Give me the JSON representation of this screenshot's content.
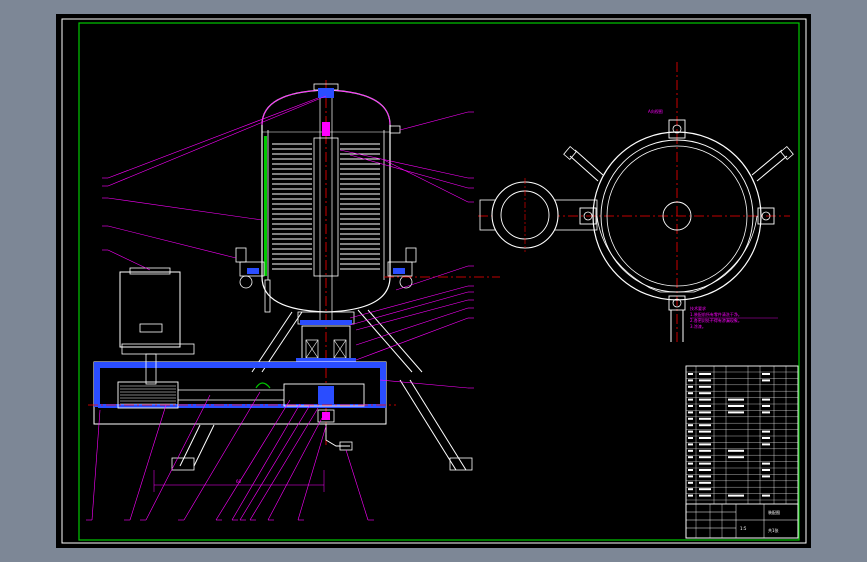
{
  "drawing": {
    "background": "#7d8796",
    "sheet_color": "#000000",
    "frame_color": "#00c800",
    "view_label": "A向视图",
    "dimension": "60",
    "tech_notes": [
      "技术要求",
      "1.装配前所有零件清洗干净。",
      "2.各密封处不得有渗漏现象。",
      "3.涂漆。"
    ],
    "title_block": {
      "title": "装配图",
      "scale": "1:5",
      "sheet": "共1张"
    }
  },
  "colors": {
    "body": "#ffffff",
    "center": "#ff0000",
    "leader": "#ff00ff",
    "blue": "#2a4dff",
    "green": "#00c800",
    "yellow": "#ffff00"
  }
}
